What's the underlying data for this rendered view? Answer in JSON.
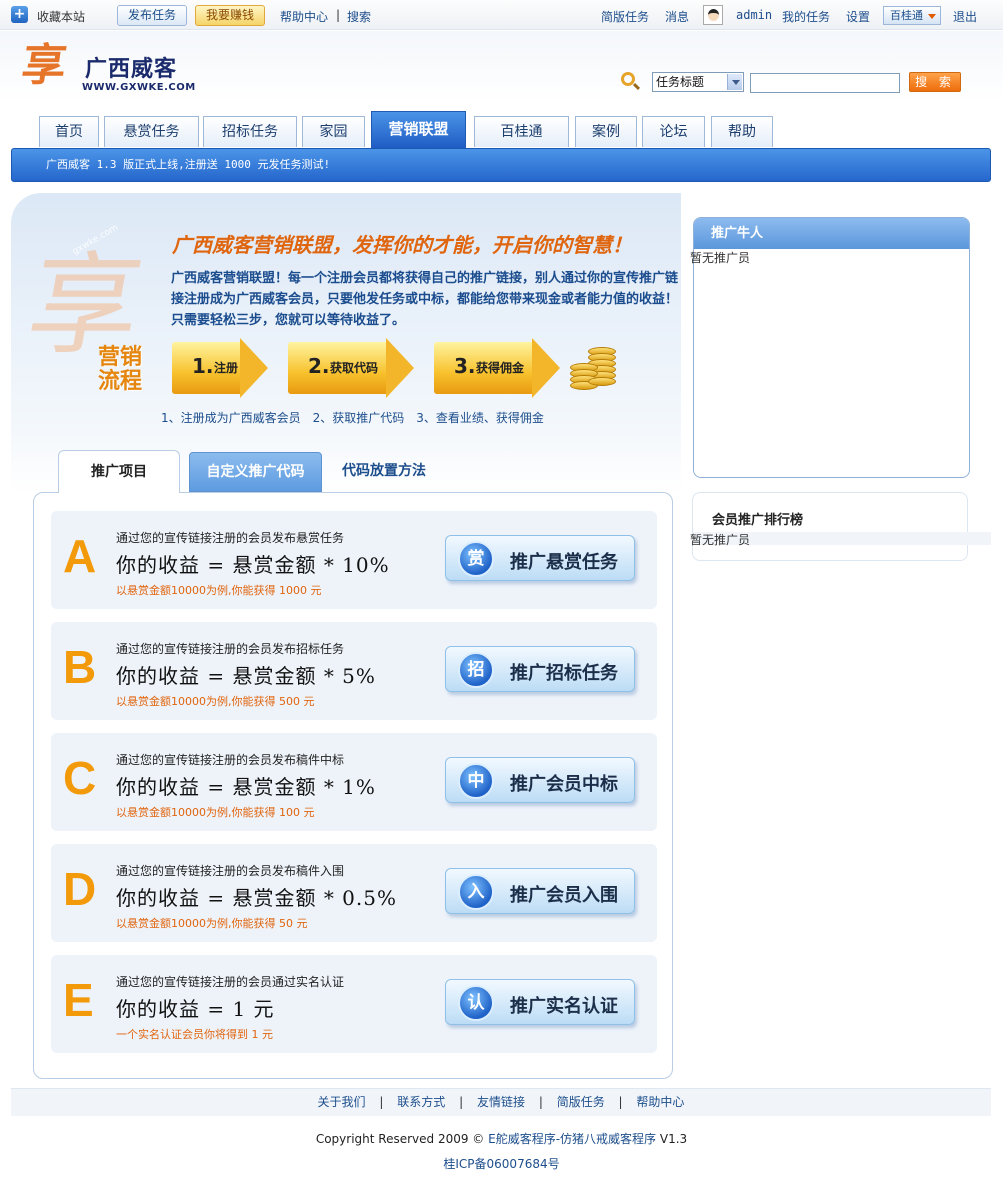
{
  "topbar": {
    "favorite": "收藏本站",
    "publish_task": "发布任务",
    "earn_money": "我要赚钱",
    "help_center": "帮助中心",
    "separator": "|",
    "search": "搜索",
    "simple_tasks": "简版任务",
    "messages": "消息",
    "username": "admin",
    "my_tasks": "我的任务",
    "settings": "设置",
    "baiguitong": "百桂通",
    "logout": "退出"
  },
  "logo": {
    "mark": "享",
    "name": "广西威客",
    "domain": "WWW.GXWKE.COM"
  },
  "search_bar": {
    "select_value": "任务标题",
    "input_value": "",
    "button": "搜 索"
  },
  "nav": {
    "tabs": [
      "首页",
      "悬赏任务",
      "招标任务",
      "家园",
      "营销联盟",
      "百桂通",
      "案例",
      "论坛",
      "帮助"
    ],
    "active": "营销联盟"
  },
  "notice": "广西威客 1.3 版正式上线,注册送 1000 元发任务测试!",
  "promo": {
    "title": "广西威客营销联盟，发挥你的才能，开启你的智慧！",
    "description": "广西威客营销联盟！每一个注册会员都将获得自己的推广链接，别人通过你的宣传推广链接注册成为广西威客会员，只要他发任务或中标，都能给您带来现金或者能力值的收益！ 只需要轻松三步，您就可以等待收益了。",
    "deco_url": "gxwke.com",
    "flow_label": [
      "营销",
      "流程"
    ],
    "steps": [
      {
        "num": "1.",
        "label": "注册"
      },
      {
        "num": "2.",
        "label": "获取代码"
      },
      {
        "num": "3.",
        "label": "获得佣金"
      }
    ],
    "step_caption": "1、注册成为广西威客会员　2、获取推广代码　3、查看业绩、获得佣金"
  },
  "panel_tabs": {
    "projects": "推广项目",
    "custom_code": "自定义推广代码",
    "placement": "代码放置方法"
  },
  "items": [
    {
      "letter": "A",
      "desc": "通过您的宣传链接注册的会员发布悬赏任务",
      "formula": "你的收益 = 悬赏金额 * 10%",
      "example": "以悬赏金额10000为例,你能获得 1000 元",
      "badge": "赏",
      "button": "推广悬赏任务"
    },
    {
      "letter": "B",
      "desc": "通过您的宣传链接注册的会员发布招标任务",
      "formula": "你的收益 = 悬赏金额 * 5%",
      "example": "以悬赏金额10000为例,你能获得 500 元",
      "badge": "招",
      "button": "推广招标任务"
    },
    {
      "letter": "C",
      "desc": "通过您的宣传链接注册的会员发布稿件中标",
      "formula": "你的收益 = 悬赏金额 * 1%",
      "example": "以悬赏金额10000为例,你能获得 100 元",
      "badge": "中",
      "button": "推广会员中标"
    },
    {
      "letter": "D",
      "desc": "通过您的宣传链接注册的会员发布稿件入围",
      "formula": "你的收益 = 悬赏金额 * 0.5%",
      "example": "以悬赏金额10000为例,你能获得 50 元",
      "badge": "入",
      "button": "推广会员入围"
    },
    {
      "letter": "E",
      "desc": "通过您的宣传链接注册的会员通过实名认证",
      "formula": "你的收益 = 1 元",
      "example": "一个实名认证会员你将得到 1 元",
      "badge": "认",
      "button": "推广实名认证"
    }
  ],
  "sidebar": {
    "top_promoters_title": "推广牛人",
    "top_promoters_empty": "暂无推广员",
    "ranking_title": "会员推广排行榜",
    "ranking_empty": "暂无推广员"
  },
  "footer": {
    "links": [
      "关于我们",
      "联系方式",
      "友情链接",
      "简版任务",
      "帮助中心"
    ],
    "separator": "|",
    "copyright_prefix": "Copyright Reserved 2009 © ",
    "copyright_link": "E舵威客程序-仿猪八戒威客程序",
    "copyright_version": " V1.3",
    "icp": "桂ICP备06007684号"
  },
  "colors": {
    "nav_active": "#1e5bc4",
    "accent_orange": "#e0650f",
    "letter_orange": "#f39a0a",
    "link_blue": "#1d4e8c"
  }
}
